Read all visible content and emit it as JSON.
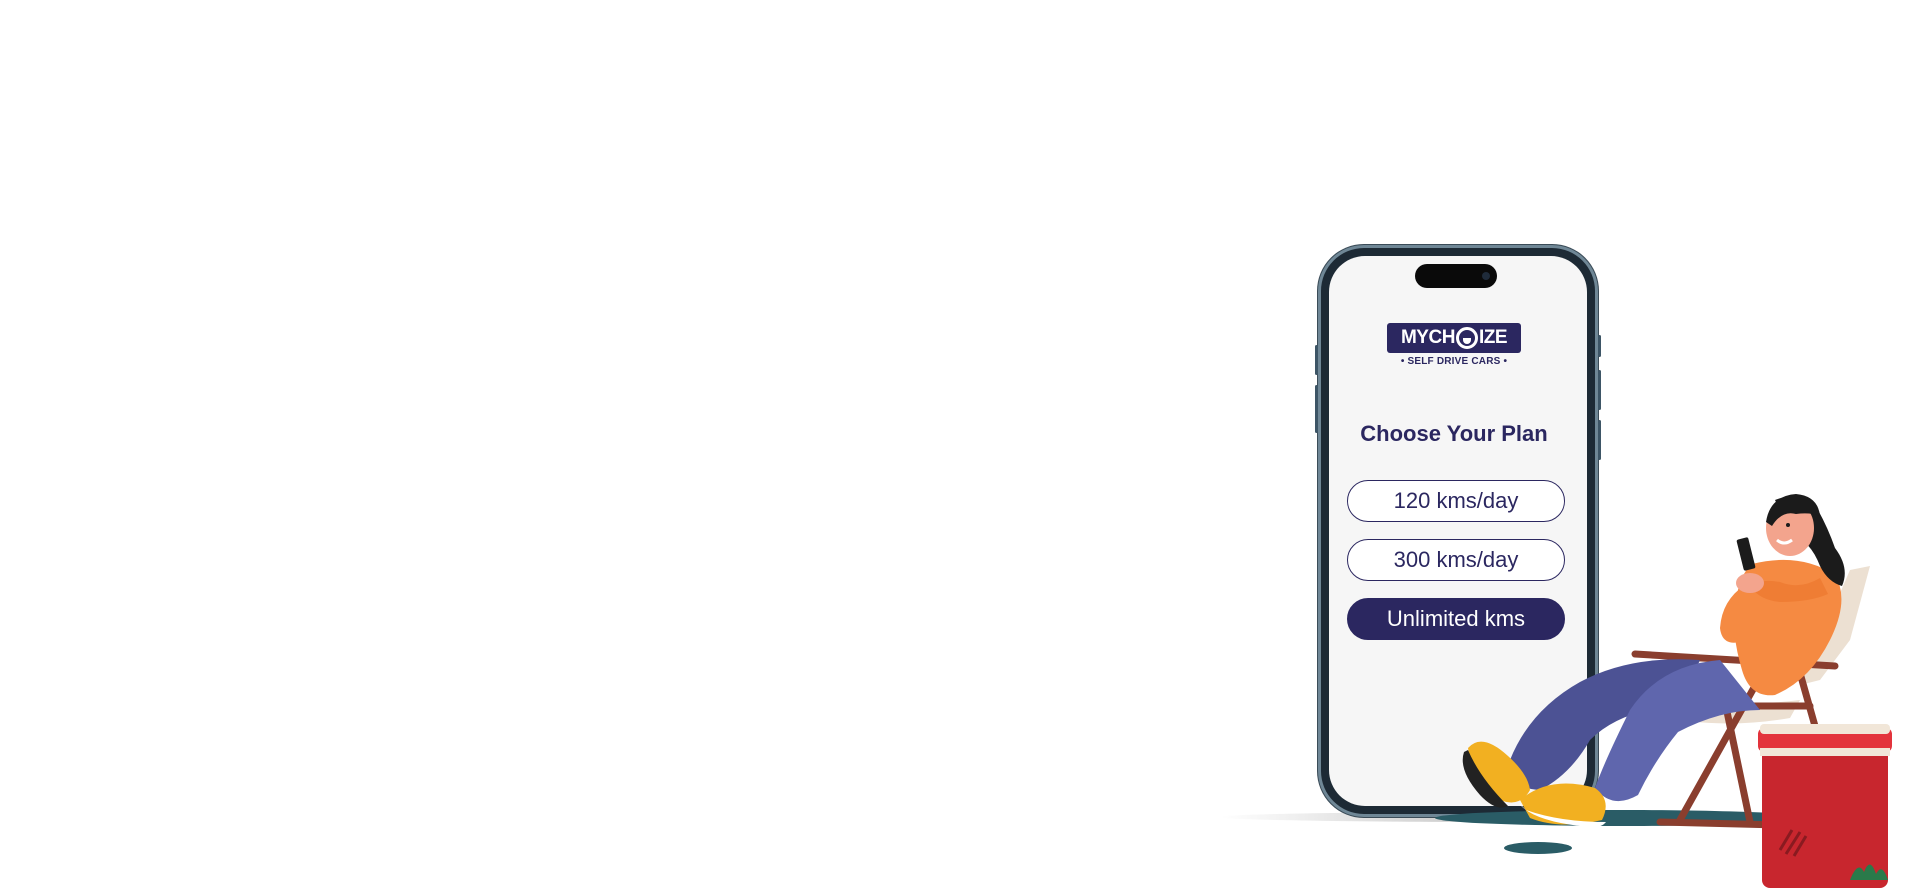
{
  "brand": {
    "logo_left": "MYCH",
    "logo_right": "IZE",
    "tagline": "• SELF DRIVE CARS •"
  },
  "plan": {
    "title": "Choose Your Plan",
    "options": [
      {
        "label": "120 kms/day",
        "selected": false
      },
      {
        "label": "300 kms/day",
        "selected": false
      },
      {
        "label": "Unlimited kms",
        "selected": true
      }
    ]
  },
  "colors": {
    "brand_navy": "#2b2760",
    "screen_bg": "#f6f6f6",
    "sweater_orange": "#f58a42",
    "pants_blue": "#5a60a8",
    "cooler_red": "#c8262e"
  },
  "icons": {
    "logo_wheel": "steering-wheel-icon",
    "illustration": "woman-in-chair-with-phone-illustration"
  }
}
